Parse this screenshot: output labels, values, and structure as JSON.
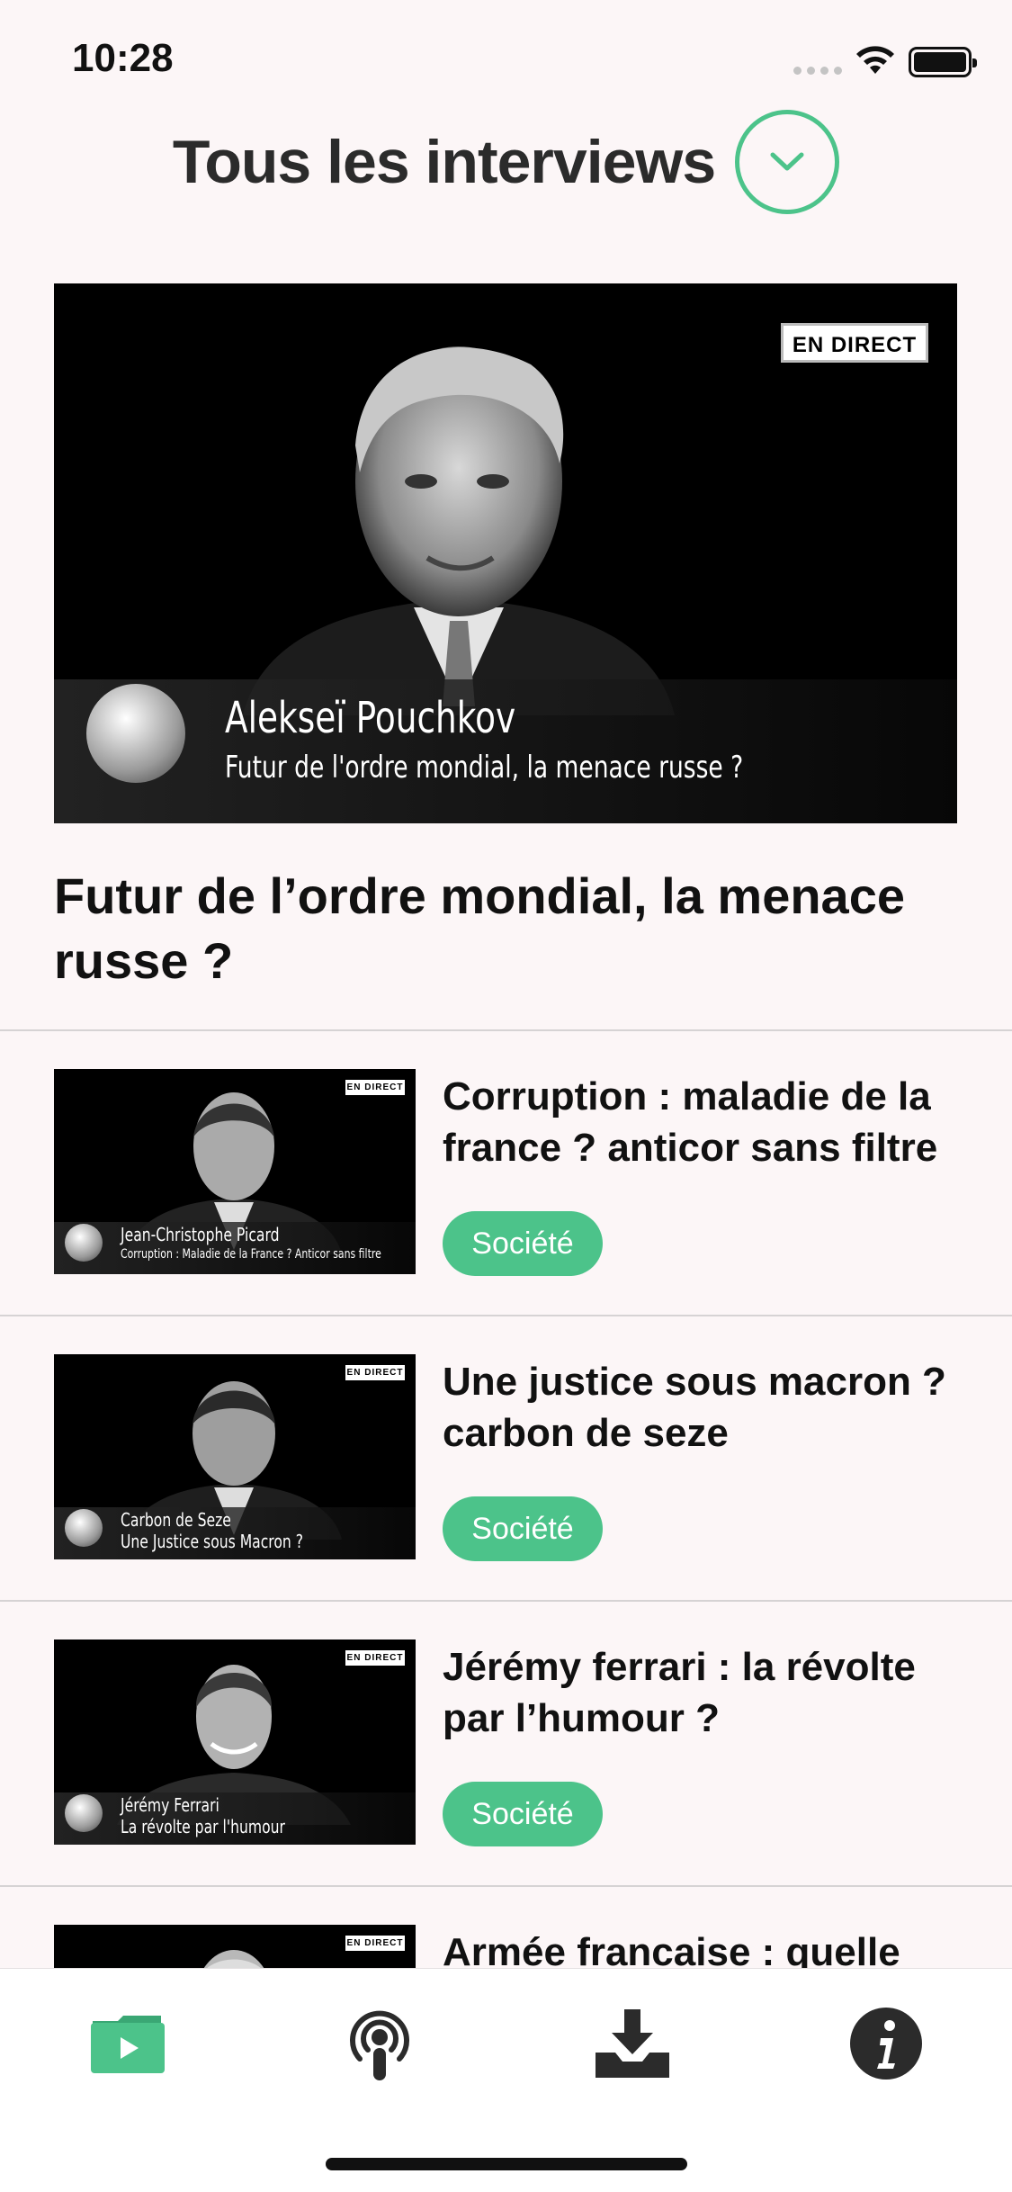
{
  "status_bar": {
    "time": "10:28"
  },
  "header": {
    "title": "Tous les interviews"
  },
  "featured": {
    "badge": "EN DIRECT",
    "caption_name": "Alekseï Pouchkov",
    "caption_subtitle": "Futur de l'ordre mondial, la menace russe ?",
    "title": "Futur de l’ordre mondial, la menace russe ?"
  },
  "items": [
    {
      "badge": "EN DIRECT",
      "caption_name": "Jean-Christophe Picard",
      "caption_subtitle": "Corruption : Maladie de la France ? Anticor sans filtre",
      "title": "Corruption : maladie de la france ? anticor sans filtre",
      "tag": "Société"
    },
    {
      "badge": "EN DIRECT",
      "caption_name": "Carbon de Seze",
      "caption_subtitle": "Une Justice sous Macron ?",
      "title": "Une justice sous macron ? carbon de seze",
      "tag": "Société"
    },
    {
      "badge": "EN DIRECT",
      "caption_name": "Jérémy Ferrari",
      "caption_subtitle": "La révolte par l'humour",
      "title": "Jérémy ferrari : la révolte par l’humour ?",
      "tag": "Société"
    },
    {
      "badge": "EN DIRECT",
      "title": "Armée francaise : quelle"
    }
  ],
  "tabbar": {
    "tabs": [
      {
        "icon": "video-folder-icon",
        "active": true
      },
      {
        "icon": "podcast-icon",
        "active": false
      },
      {
        "icon": "download-icon",
        "active": false
      },
      {
        "icon": "info-icon",
        "active": false
      }
    ],
    "accent_color": "#4cc38a"
  }
}
